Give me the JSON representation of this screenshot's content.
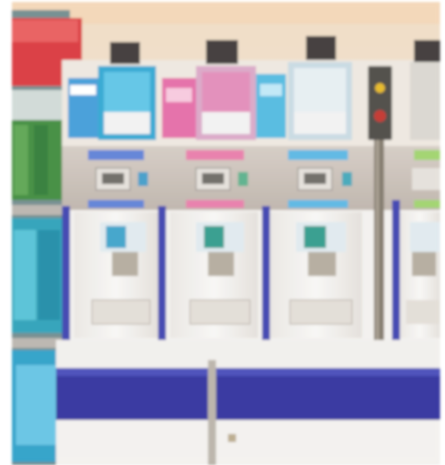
{
  "image": {
    "kind": "photo",
    "subject": "vending-machine-row",
    "colors": {
      "frame": "#ffffff",
      "wall": "#e9e2d6",
      "ceiling": "#f0dcc4",
      "panel": "#c9bfb6",
      "cabinet": "#f3f1ee",
      "stripe": "#2d2f9c",
      "post": "#7f7668",
      "label_blue": "#3fb6de",
      "label_pink": "#e46ba6",
      "label_green": "#8cc84a",
      "bottle_red": "#d9343a",
      "bottle_teal": "#2aa0b8",
      "bottle_green": "#3e8a3a"
    },
    "units": [
      {
        "label_color": "#3f9bd8",
        "tag_color": "#5c7fd6"
      },
      {
        "label_color": "#e15a9d",
        "tag_color": "#e87aa9"
      },
      {
        "label_color": "#4fb9e0",
        "tag_color": "#59b6e3"
      },
      {
        "label_color": "#8ccf54",
        "tag_color": "#9ed36a"
      }
    ],
    "icons": [
      "coin-slot-icon",
      "product-window-icon",
      "dispense-tray-icon"
    ]
  }
}
